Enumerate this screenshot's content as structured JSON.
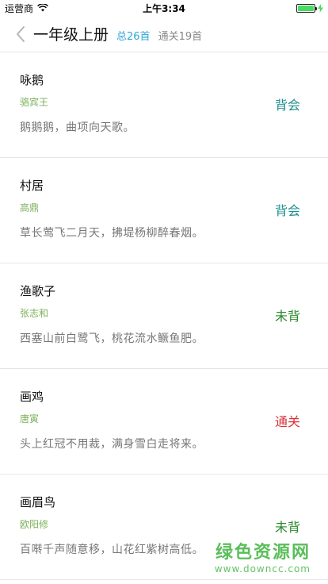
{
  "status_bar": {
    "carrier": "运营商",
    "time": "上午3:34",
    "battery_level": 1.0
  },
  "header": {
    "title": "一年级上册",
    "total": "总26首",
    "passed": "通关19首"
  },
  "colors": {
    "status_memorized": "#1f8f8f",
    "status_not_memorized": "#2a8a2a",
    "status_passed": "#d6333a"
  },
  "poems": [
    {
      "title": "咏鹅",
      "author": "骆宾王",
      "line": "鹅鹅鹅，曲项向天歌。",
      "status": "背会"
    },
    {
      "title": "村居",
      "author": "高鼎",
      "line": "草长莺飞二月天，拂堤杨柳醉春烟。",
      "status": "背会"
    },
    {
      "title": "渔歌子",
      "author": "张志和",
      "line": "西塞山前白鹭飞，桃花流水鳜鱼肥。",
      "status": "未背"
    },
    {
      "title": "画鸡",
      "author": "唐寅",
      "line": "头上红冠不用裁，满身雪白走将来。",
      "status": "通关"
    },
    {
      "title": "画眉鸟",
      "author": "欧阳修",
      "line": "百啭千声随意移，山花红紫树高低。",
      "status": "未背"
    }
  ],
  "watermark": {
    "text": "绿色资源网",
    "url": "www.downcc.com"
  }
}
